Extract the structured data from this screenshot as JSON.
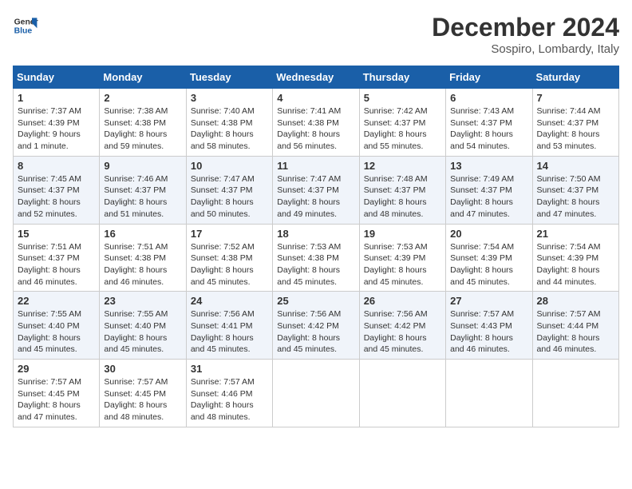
{
  "header": {
    "logo_line1": "General",
    "logo_line2": "Blue",
    "month": "December 2024",
    "location": "Sospiro, Lombardy, Italy"
  },
  "days_of_week": [
    "Sunday",
    "Monday",
    "Tuesday",
    "Wednesday",
    "Thursday",
    "Friday",
    "Saturday"
  ],
  "weeks": [
    [
      {
        "day": 1,
        "sunrise": "7:37 AM",
        "sunset": "4:39 PM",
        "daylight": "9 hours and 1 minute."
      },
      {
        "day": 2,
        "sunrise": "7:38 AM",
        "sunset": "4:38 PM",
        "daylight": "8 hours and 59 minutes."
      },
      {
        "day": 3,
        "sunrise": "7:40 AM",
        "sunset": "4:38 PM",
        "daylight": "8 hours and 58 minutes."
      },
      {
        "day": 4,
        "sunrise": "7:41 AM",
        "sunset": "4:38 PM",
        "daylight": "8 hours and 56 minutes."
      },
      {
        "day": 5,
        "sunrise": "7:42 AM",
        "sunset": "4:37 PM",
        "daylight": "8 hours and 55 minutes."
      },
      {
        "day": 6,
        "sunrise": "7:43 AM",
        "sunset": "4:37 PM",
        "daylight": "8 hours and 54 minutes."
      },
      {
        "day": 7,
        "sunrise": "7:44 AM",
        "sunset": "4:37 PM",
        "daylight": "8 hours and 53 minutes."
      }
    ],
    [
      {
        "day": 8,
        "sunrise": "7:45 AM",
        "sunset": "4:37 PM",
        "daylight": "8 hours and 52 minutes."
      },
      {
        "day": 9,
        "sunrise": "7:46 AM",
        "sunset": "4:37 PM",
        "daylight": "8 hours and 51 minutes."
      },
      {
        "day": 10,
        "sunrise": "7:47 AM",
        "sunset": "4:37 PM",
        "daylight": "8 hours and 50 minutes."
      },
      {
        "day": 11,
        "sunrise": "7:47 AM",
        "sunset": "4:37 PM",
        "daylight": "8 hours and 49 minutes."
      },
      {
        "day": 12,
        "sunrise": "7:48 AM",
        "sunset": "4:37 PM",
        "daylight": "8 hours and 48 minutes."
      },
      {
        "day": 13,
        "sunrise": "7:49 AM",
        "sunset": "4:37 PM",
        "daylight": "8 hours and 47 minutes."
      },
      {
        "day": 14,
        "sunrise": "7:50 AM",
        "sunset": "4:37 PM",
        "daylight": "8 hours and 47 minutes."
      }
    ],
    [
      {
        "day": 15,
        "sunrise": "7:51 AM",
        "sunset": "4:37 PM",
        "daylight": "8 hours and 46 minutes."
      },
      {
        "day": 16,
        "sunrise": "7:51 AM",
        "sunset": "4:38 PM",
        "daylight": "8 hours and 46 minutes."
      },
      {
        "day": 17,
        "sunrise": "7:52 AM",
        "sunset": "4:38 PM",
        "daylight": "8 hours and 45 minutes."
      },
      {
        "day": 18,
        "sunrise": "7:53 AM",
        "sunset": "4:38 PM",
        "daylight": "8 hours and 45 minutes."
      },
      {
        "day": 19,
        "sunrise": "7:53 AM",
        "sunset": "4:39 PM",
        "daylight": "8 hours and 45 minutes."
      },
      {
        "day": 20,
        "sunrise": "7:54 AM",
        "sunset": "4:39 PM",
        "daylight": "8 hours and 45 minutes."
      },
      {
        "day": 21,
        "sunrise": "7:54 AM",
        "sunset": "4:39 PM",
        "daylight": "8 hours and 44 minutes."
      }
    ],
    [
      {
        "day": 22,
        "sunrise": "7:55 AM",
        "sunset": "4:40 PM",
        "daylight": "8 hours and 45 minutes."
      },
      {
        "day": 23,
        "sunrise": "7:55 AM",
        "sunset": "4:40 PM",
        "daylight": "8 hours and 45 minutes."
      },
      {
        "day": 24,
        "sunrise": "7:56 AM",
        "sunset": "4:41 PM",
        "daylight": "8 hours and 45 minutes."
      },
      {
        "day": 25,
        "sunrise": "7:56 AM",
        "sunset": "4:42 PM",
        "daylight": "8 hours and 45 minutes."
      },
      {
        "day": 26,
        "sunrise": "7:56 AM",
        "sunset": "4:42 PM",
        "daylight": "8 hours and 45 minutes."
      },
      {
        "day": 27,
        "sunrise": "7:57 AM",
        "sunset": "4:43 PM",
        "daylight": "8 hours and 46 minutes."
      },
      {
        "day": 28,
        "sunrise": "7:57 AM",
        "sunset": "4:44 PM",
        "daylight": "8 hours and 46 minutes."
      }
    ],
    [
      {
        "day": 29,
        "sunrise": "7:57 AM",
        "sunset": "4:45 PM",
        "daylight": "8 hours and 47 minutes."
      },
      {
        "day": 30,
        "sunrise": "7:57 AM",
        "sunset": "4:45 PM",
        "daylight": "8 hours and 48 minutes."
      },
      {
        "day": 31,
        "sunrise": "7:57 AM",
        "sunset": "4:46 PM",
        "daylight": "8 hours and 48 minutes."
      },
      null,
      null,
      null,
      null
    ]
  ]
}
